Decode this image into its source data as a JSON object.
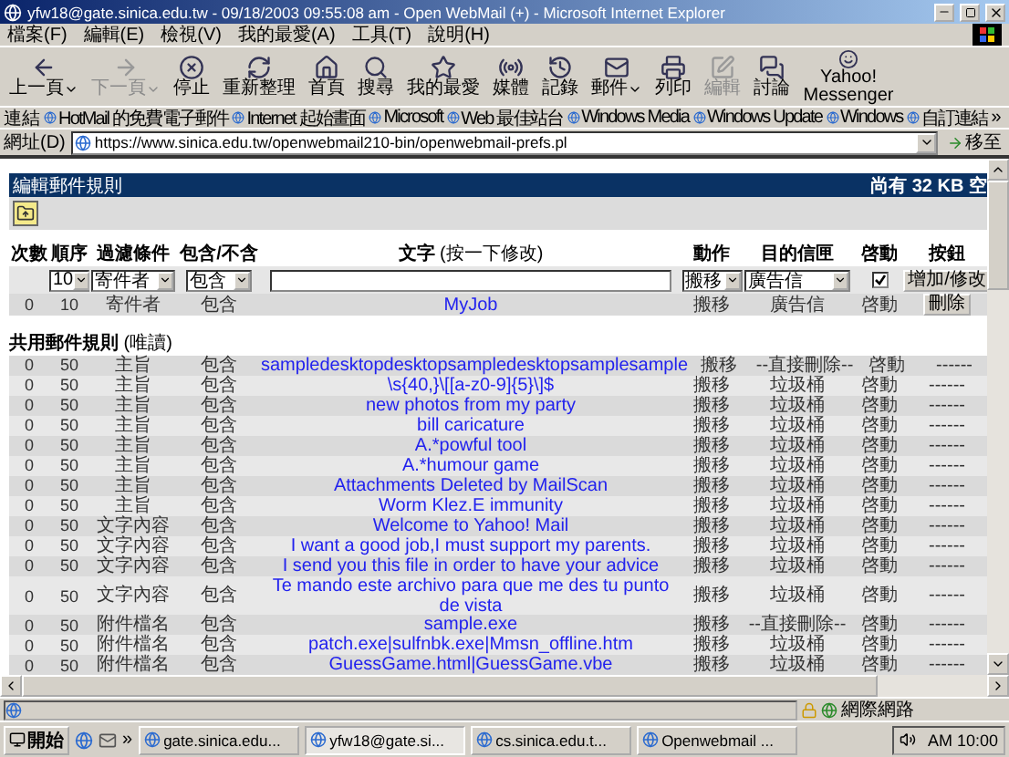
{
  "window": {
    "title": "yfw18@gate.sinica.edu.tw - 09/18/2003 09:55:08 am - Open WebMail (+) - Microsoft Internet Explorer"
  },
  "menu": [
    "檔案(F)",
    "編輯(E)",
    "檢視(V)",
    "我的最愛(A)",
    "工具(T)",
    "說明(H)"
  ],
  "toolbar": [
    {
      "label": "上一頁",
      "dropdown": true,
      "disabled": false
    },
    {
      "label": "下一頁",
      "dropdown": true,
      "disabled": true
    },
    {
      "label": "停止",
      "dropdown": false,
      "disabled": false
    },
    {
      "label": "重新整理",
      "dropdown": false,
      "disabled": false
    },
    {
      "label": "首頁",
      "dropdown": false,
      "disabled": false
    },
    {
      "label": "搜尋",
      "dropdown": false,
      "disabled": false
    },
    {
      "label": "我的最愛",
      "dropdown": false,
      "disabled": false
    },
    {
      "label": "媒體",
      "dropdown": false,
      "disabled": false
    },
    {
      "label": "記錄",
      "dropdown": false,
      "disabled": false
    },
    {
      "label": "郵件",
      "dropdown": true,
      "disabled": false
    },
    {
      "label": "列印",
      "dropdown": false,
      "disabled": false
    },
    {
      "label": "編輯",
      "dropdown": false,
      "disabled": true
    },
    {
      "label": "討論",
      "dropdown": false,
      "disabled": false
    },
    {
      "label": "Yahoo! Messenger",
      "dropdown": false,
      "disabled": false
    }
  ],
  "links": {
    "label": "連結",
    "items": [
      "HotMail 的免費電子郵件",
      "Internet 起始畫面",
      "Microsoft",
      "Web 最佳站台",
      "Windows Media",
      "Windows Update",
      "Windows",
      "自訂連結"
    ],
    "more": "»"
  },
  "address": {
    "label": "網址(D)",
    "value": "https://www.sinica.edu.tw/openwebmail210-bin/openwebmail-prefs.pl",
    "go": "移至"
  },
  "page": {
    "title": "編輯郵件規則",
    "quota": "尚有 32 KB 空",
    "columns": [
      {
        "label": "次數"
      },
      {
        "label": "順序"
      },
      {
        "label": "過濾條件"
      },
      {
        "label": "包含/不含"
      },
      {
        "label": "文字",
        "hint": "(按一下修改)"
      },
      {
        "label": "動作"
      },
      {
        "label": "目的信匣"
      },
      {
        "label": "啓動"
      },
      {
        "label": "按鈕"
      }
    ],
    "new_rule": {
      "order": "10",
      "field": "寄件者",
      "condition": "包含",
      "action": "搬移",
      "destination": "廣告信",
      "enabled": true,
      "button": "增加/修改"
    },
    "rules": [
      {
        "count": "0",
        "order": "10",
        "field": "寄件者",
        "condition": "包含",
        "text": "MyJob",
        "action": "搬移",
        "destination": "廣告信",
        "status": "啓動",
        "button": "刪除"
      }
    ],
    "shared_title": "共用郵件規則",
    "shared_note": "(唯讀)",
    "shared_rules": [
      {
        "count": "0",
        "order": "50",
        "field": "主旨",
        "condition": "包含",
        "text": "sampledesktopdesktopsampledesktopsamplesample",
        "action": "搬移",
        "destination": "--直接刪除--",
        "status": "啓動",
        "button": "------"
      },
      {
        "count": "0",
        "order": "50",
        "field": "主旨",
        "condition": "包含",
        "text": "\\s{40,}\\[[a-z0-9]{5}\\]$",
        "action": "搬移",
        "destination": "垃圾桶",
        "status": "啓動",
        "button": "------"
      },
      {
        "count": "0",
        "order": "50",
        "field": "主旨",
        "condition": "包含",
        "text": "new photos from my party",
        "action": "搬移",
        "destination": "垃圾桶",
        "status": "啓動",
        "button": "------"
      },
      {
        "count": "0",
        "order": "50",
        "field": "主旨",
        "condition": "包含",
        "text": "bill caricature",
        "action": "搬移",
        "destination": "垃圾桶",
        "status": "啓動",
        "button": "------"
      },
      {
        "count": "0",
        "order": "50",
        "field": "主旨",
        "condition": "包含",
        "text": "A.*powful tool",
        "action": "搬移",
        "destination": "垃圾桶",
        "status": "啓動",
        "button": "------"
      },
      {
        "count": "0",
        "order": "50",
        "field": "主旨",
        "condition": "包含",
        "text": "A.*humour game",
        "action": "搬移",
        "destination": "垃圾桶",
        "status": "啓動",
        "button": "------"
      },
      {
        "count": "0",
        "order": "50",
        "field": "主旨",
        "condition": "包含",
        "text": "Attachments Deleted by MailScan",
        "action": "搬移",
        "destination": "垃圾桶",
        "status": "啓動",
        "button": "------"
      },
      {
        "count": "0",
        "order": "50",
        "field": "主旨",
        "condition": "包含",
        "text": "Worm Klez.E immunity",
        "action": "搬移",
        "destination": "垃圾桶",
        "status": "啓動",
        "button": "------"
      },
      {
        "count": "0",
        "order": "50",
        "field": "文字內容",
        "condition": "包含",
        "text": "Welcome to Yahoo! Mail",
        "action": "搬移",
        "destination": "垃圾桶",
        "status": "啓動",
        "button": "------"
      },
      {
        "count": "0",
        "order": "50",
        "field": "文字內容",
        "condition": "包含",
        "text": "I want a good job,I must support my parents.",
        "action": "搬移",
        "destination": "垃圾桶",
        "status": "啓動",
        "button": "------"
      },
      {
        "count": "0",
        "order": "50",
        "field": "文字內容",
        "condition": "包含",
        "text": "I send you this file in order to have your advice",
        "action": "搬移",
        "destination": "垃圾桶",
        "status": "啓動",
        "button": "------"
      },
      {
        "count": "0",
        "order": "50",
        "field": "文字內容",
        "condition": "包含",
        "text": "Te mando este archivo para que me des tu punto de vista",
        "action": "搬移",
        "destination": "垃圾桶",
        "status": "啓動",
        "button": "------"
      },
      {
        "count": "0",
        "order": "50",
        "field": "附件檔名",
        "condition": "包含",
        "text": "sample.exe",
        "action": "搬移",
        "destination": "--直接刪除--",
        "status": "啓動",
        "button": "------"
      },
      {
        "count": "0",
        "order": "50",
        "field": "附件檔名",
        "condition": "包含",
        "text": "patch.exe|sulfnbk.exe|Mmsn_offline.htm",
        "action": "搬移",
        "destination": "垃圾桶",
        "status": "啓動",
        "button": "------"
      },
      {
        "count": "0",
        "order": "50",
        "field": "附件檔名",
        "condition": "包含",
        "text": "GuessGame.html|GuessGame.vbe",
        "action": "搬移",
        "destination": "垃圾桶",
        "status": "啓動",
        "button": "------"
      }
    ]
  },
  "status_bar": {
    "zone": "網際網路"
  },
  "taskbar": {
    "start": "開始",
    "more": "»",
    "tasks": [
      {
        "label": "gate.sinica.edu...",
        "selected": false
      },
      {
        "label": "yfw18@gate.si...",
        "selected": true
      },
      {
        "label": "cs.sinica.edu.t...",
        "selected": false
      },
      {
        "label": "Openwebmail ...",
        "selected": false
      }
    ],
    "clock": "AM 10:00"
  }
}
